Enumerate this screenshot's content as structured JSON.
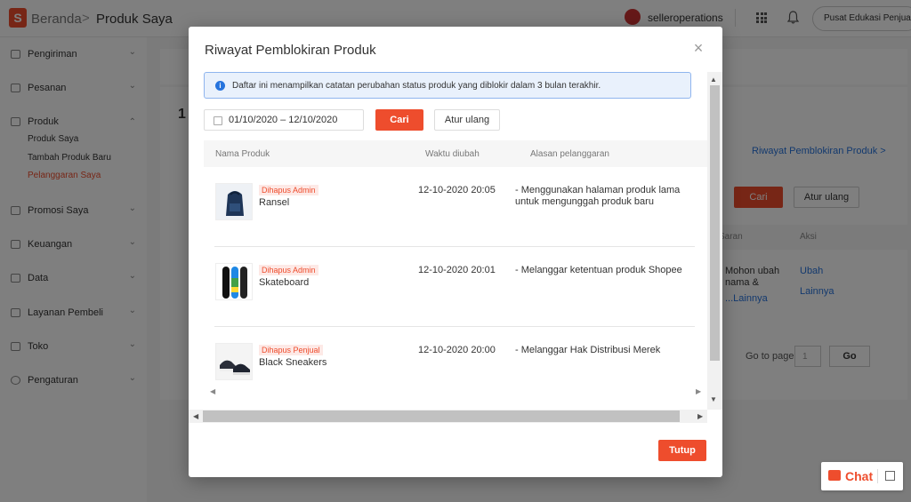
{
  "header": {
    "logo_letter": "S",
    "breadcrumb_home": "Beranda",
    "breadcrumb_separator": ">",
    "breadcrumb_current": "Produk Saya",
    "username": "selleroperations",
    "edu_button": "Pusat Edukasi Penjual"
  },
  "sidebar": {
    "items": [
      {
        "label": "Pengiriman",
        "icon": "truck-icon"
      },
      {
        "label": "Pesanan",
        "icon": "clipboard-icon"
      },
      {
        "label": "Produk",
        "icon": "box-icon"
      },
      {
        "label": "Promosi Saya",
        "icon": "tag-icon"
      },
      {
        "label": "Keuangan",
        "icon": "wallet-icon"
      },
      {
        "label": "Data",
        "icon": "chart-icon"
      },
      {
        "label": "Layanan Pembeli",
        "icon": "chat-bubble-icon"
      },
      {
        "label": "Toko",
        "icon": "store-icon"
      },
      {
        "label": "Pengaturan",
        "icon": "gear-icon"
      }
    ],
    "sub_items": [
      "Produk Saya",
      "Tambah Produk Baru",
      "Pelanggaran Saya"
    ]
  },
  "background": {
    "count": "1",
    "history_link": "Riwayat Pemblokiran Produk >",
    "cari": "Cari",
    "reset": "Atur ulang",
    "col_saran": "Saran",
    "col_aksi": "Aksi",
    "saran_text": "Mohon ubah nama &",
    "saran_more": "...Lainnya",
    "ubah": "Ubah",
    "lainnya": "Lainnya",
    "goto": "Go to page",
    "page_value": "1",
    "go": "Go"
  },
  "modal": {
    "title": "Riwayat Pemblokiran Produk",
    "info": "Daftar ini menampilkan catatan perubahan status produk yang diblokir dalam 3 bulan terakhir.",
    "date_range": "01/10/2020 – 12/10/2020",
    "search_button": "Cari",
    "reset_button": "Atur ulang",
    "columns": [
      "Nama Produk",
      "Waktu diubah",
      "Alasan pelanggaran"
    ],
    "rows": [
      {
        "badge": "Dihapus Admin",
        "name": "Ransel",
        "time": "12-10-2020 20:05",
        "reason": "- Menggunakan halaman produk lama untuk mengunggah produk baru",
        "thumb": "backpack"
      },
      {
        "badge": "Dihapus Admin",
        "name": "Skateboard",
        "time": "12-10-2020 20:01",
        "reason": "- Melanggar ketentuan produk Shopee",
        "thumb": "skateboard"
      },
      {
        "badge": "Dihapus Penjual",
        "name": "Black Sneakers",
        "time": "12-10-2020 20:00",
        "reason": "- Melanggar Hak Distribusi Merek",
        "thumb": "sneakers"
      }
    ],
    "close_button": "Tutup"
  },
  "chat": {
    "label": "Chat"
  }
}
